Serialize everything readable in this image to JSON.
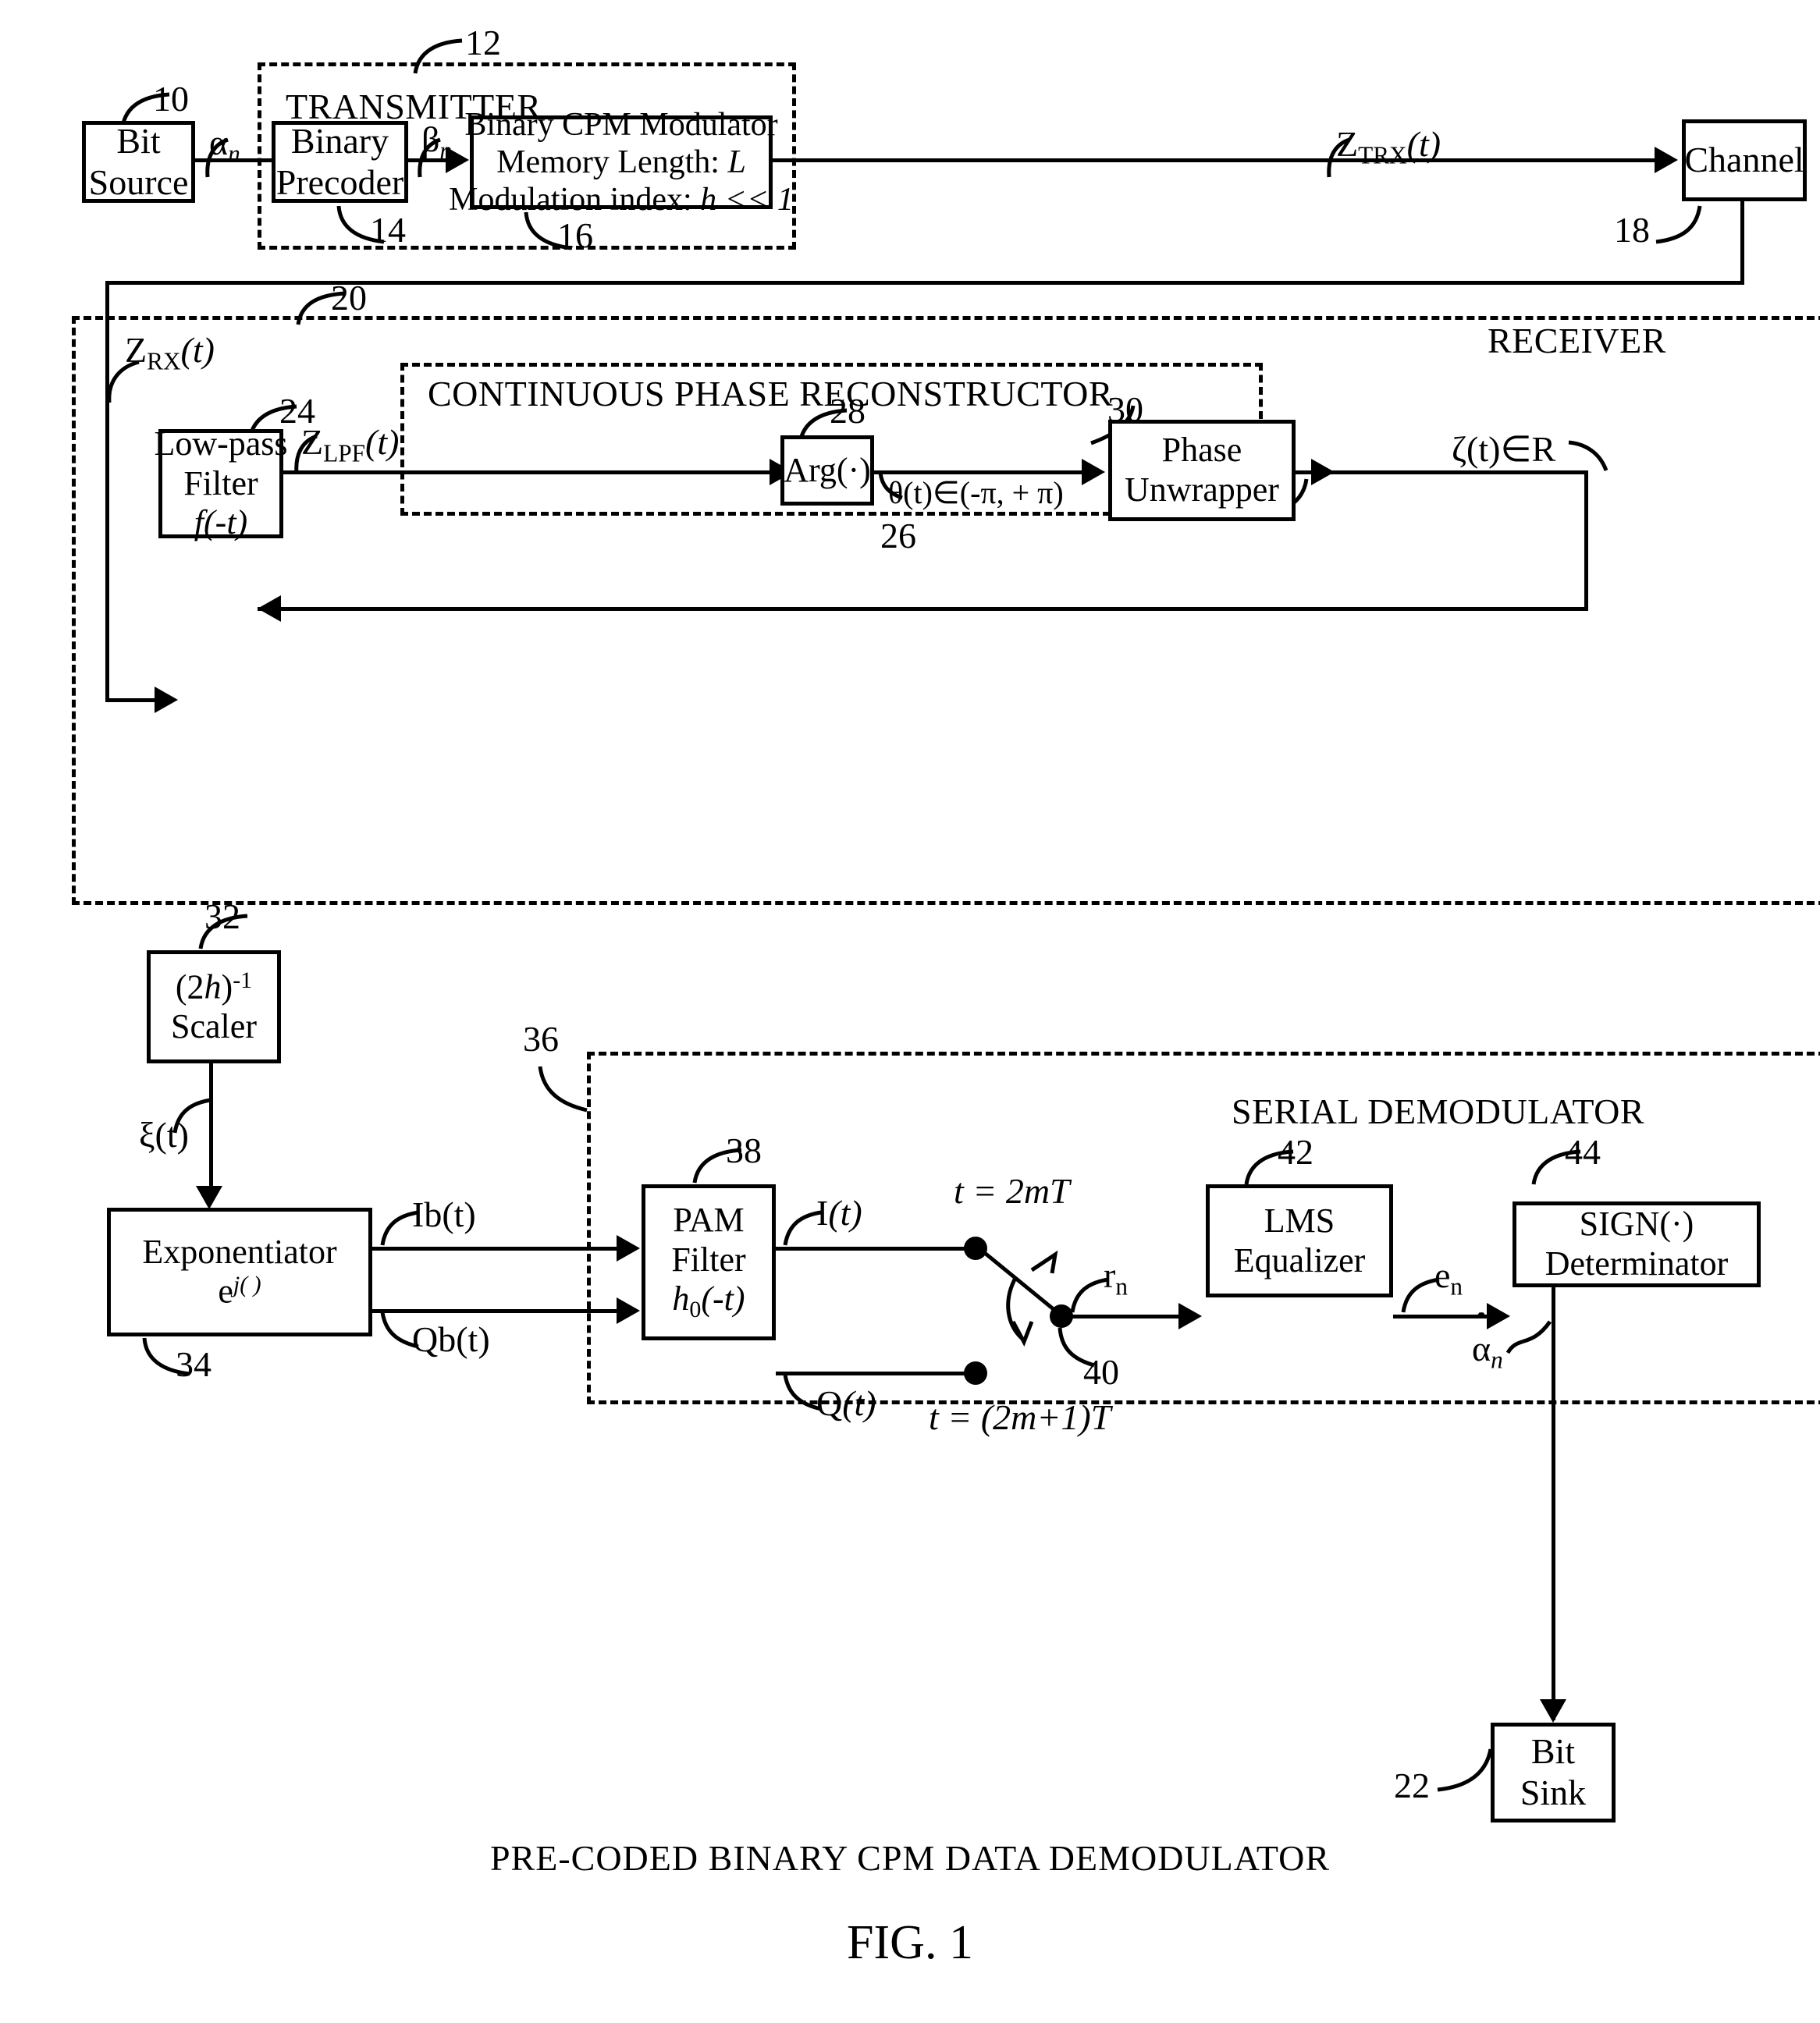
{
  "figure": {
    "caption": "PRE-CODED BINARY CPM DATA DEMODULATOR",
    "number": "FIG. 1"
  },
  "sections": {
    "transmitter": {
      "label": "TRANSMITTER",
      "ref": "12"
    },
    "receiver": {
      "label": "RECEIVER",
      "ref": "20"
    },
    "phase_reconstructor": {
      "label": "CONTINUOUS PHASE RECONSTRUCTOR",
      "ref": "26"
    },
    "serial_demodulator": {
      "label": "SERIAL DEMODULATOR",
      "ref": "36"
    }
  },
  "blocks": {
    "bit_source": {
      "line1": "Bit",
      "line2": "Source",
      "ref": "10"
    },
    "binary_precoder": {
      "line1": "Binary",
      "line2": "Precoder",
      "ref": "14"
    },
    "cpm_modulator": {
      "line1": "Binary CPM Modulator",
      "line2a": "Memory Length: ",
      "line2b": "L",
      "line3a": "Modulation index: ",
      "line3b": "h << 1",
      "ref": "16"
    },
    "channel": {
      "line1": "Channel",
      "ref": "18"
    },
    "lowpass_filter": {
      "line1": "Low-pass",
      "line2": "Filter",
      "line3": "f(-t)",
      "ref": "24"
    },
    "arg": {
      "line1": "Arg(·)",
      "ref": "28"
    },
    "phase_unwrapper": {
      "line1": "Phase",
      "line2": "Unwrapper",
      "ref": "30"
    },
    "scaler": {
      "line1a": "(2",
      "line1b": "h",
      "line1c": ")",
      "line1d": "-1",
      "line2": "Scaler",
      "ref": "32"
    },
    "exponentiator": {
      "line1": "Exponentiator",
      "line2a": "e",
      "line2b": "j( )",
      "ref": "34"
    },
    "pam_filter": {
      "line1": "PAM",
      "line2": "Filter",
      "line3a": "h",
      "line3b": "0",
      "line3c": "(-t)",
      "ref": "38"
    },
    "lms_equalizer": {
      "line1": "LMS",
      "line2": "Equalizer",
      "ref": "42"
    },
    "sign_determinator": {
      "line1": "SIGN(·)",
      "line2": "Determinator",
      "ref": "44"
    },
    "bit_sink": {
      "line1": "Bit",
      "line2": "Sink",
      "ref": "22"
    }
  },
  "signals": {
    "alpha_n": "α",
    "alpha_n_sub": "n",
    "beta_n": "β",
    "beta_n_sub": "n",
    "z_trx": "Z",
    "z_trx_sub": "TRX",
    "z_trx_arg": "(t)",
    "z_rx": "Z",
    "z_rx_sub": "RX",
    "z_rx_arg": "(t)",
    "z_lpf": "Z",
    "z_lpf_sub": "LPF",
    "z_lpf_arg": "(t)",
    "theta": "θ(t)∈(-π, + π)",
    "zeta": "ζ(t)∈R",
    "xi": "ξ(t)",
    "ib": "Ib(t)",
    "qb": "Qb(t)",
    "i_t": "I(t)",
    "q_t": "Q(t)",
    "sample_even": "t = 2mT",
    "sample_odd": "t = (2m+1)T",
    "switch_ref": "40",
    "r_n": "r",
    "r_n_sub": "n",
    "e_n": "e",
    "e_n_sub": "n",
    "alpha_hat": "α",
    "alpha_hat_sub": "n",
    "alpha_hat_mark": "ˆ"
  }
}
